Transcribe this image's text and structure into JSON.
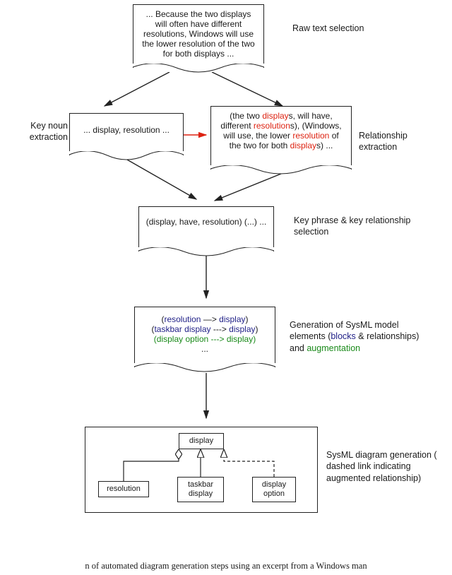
{
  "caption": "n of automated diagram generation steps using an excerpt from a Windows man",
  "steps": {
    "raw": {
      "text": "... Because the two displays will often have different resolutions, Windows will use the lower resolution of the two for both displays ...",
      "label": "Raw text selection"
    },
    "keynoun": {
      "text": "... display, resolution ...",
      "label": "Key noun extraction"
    },
    "relation": {
      "prefix": "(the two ",
      "w1": "display",
      "mid1": "s, will have, different ",
      "w2": "resolution",
      "mid2": "s), (Windows, will use, the lower ",
      "w3": "resolution",
      "mid3": " of the two for both ",
      "w4": "display",
      "suffix": "s) ...",
      "label": "Relationship extraction"
    },
    "keyphrase": {
      "text": "(display, have, resolution)  (...) ...",
      "label": "Key phrase & key relationship selection"
    },
    "generation": {
      "line1_a": "(",
      "line1_b": "resolution",
      "line1_c": " —> ",
      "line1_d": "display",
      "line1_e": ")",
      "line2_a": "(",
      "line2_b": "taskbar display",
      "line2_c": " ---> ",
      "line2_d": "display",
      "line2_e": ")",
      "line3": "(display option ---> display)",
      "ell": "...",
      "label_a": "Generation of SysML model elements (",
      "label_blocks": "blocks",
      "label_b": " & relationships) and ",
      "label_aug": "augmentation"
    },
    "sysml": {
      "display": "display",
      "resolution": "resolution",
      "taskbar": "taskbar display",
      "option": "display option",
      "label": "SysML diagram generation ( dashed link indicating augmented relationship)"
    }
  }
}
